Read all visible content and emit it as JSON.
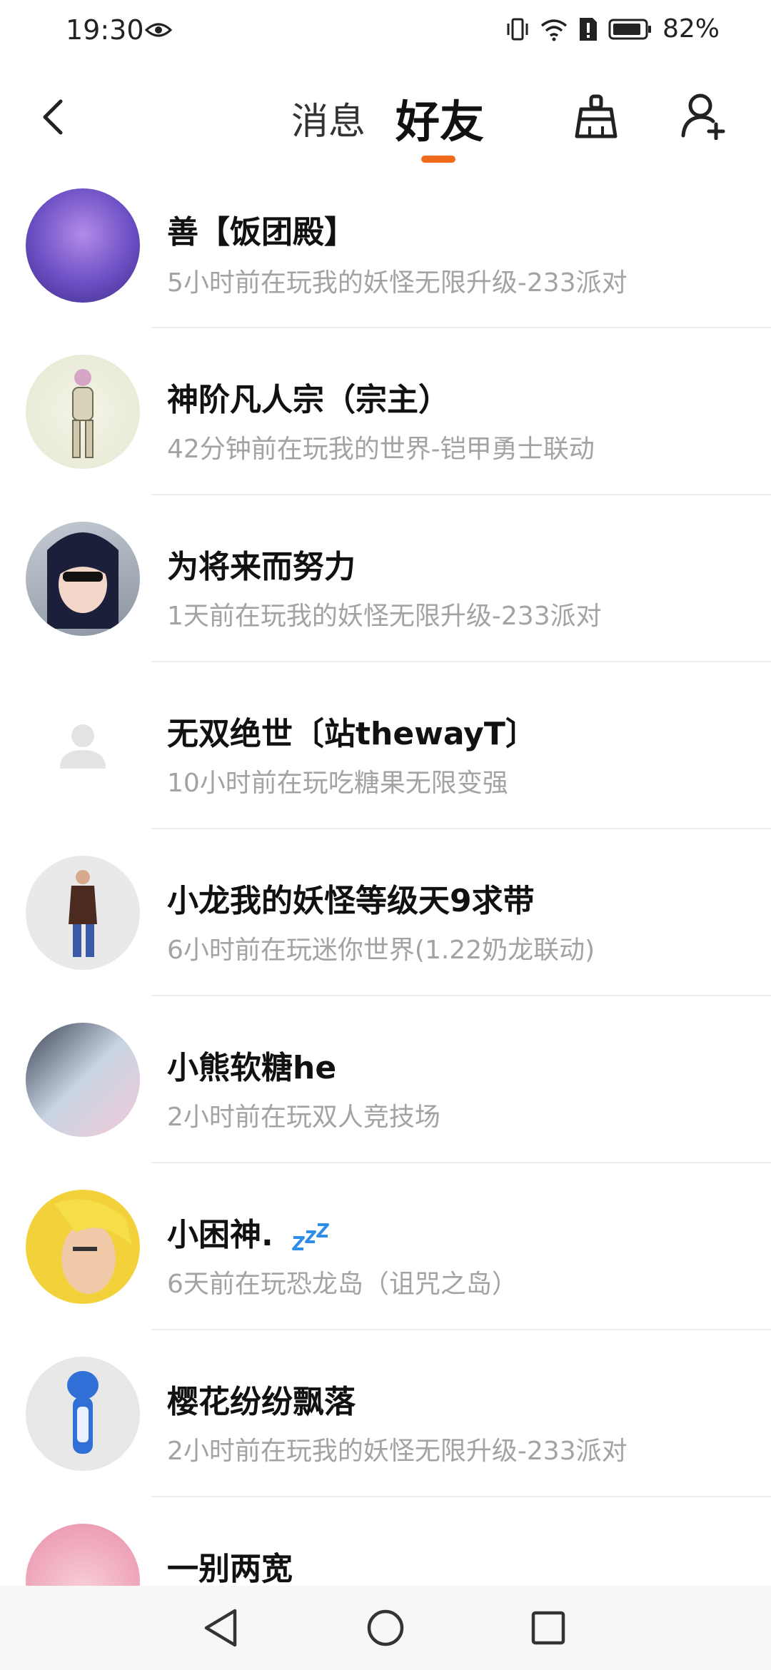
{
  "status_bar": {
    "time": "19:30",
    "battery_percent": "82%"
  },
  "header": {
    "tab_messages": "消息",
    "tab_friends": "好友",
    "accent_color": "#f26a1b"
  },
  "friends": [
    {
      "name": "善【饭团殿】",
      "status": "5小时前在玩我的妖怪无限升级-233派对",
      "avatar_color": "#6b4fc4"
    },
    {
      "name": "神阶凡人宗（宗主）",
      "status": "42分钟前在玩我的世界-铠甲勇士联动",
      "avatar_color": "#eeeede"
    },
    {
      "name": "为将来而努力",
      "status": "1天前在玩我的妖怪无限升级-233派对",
      "avatar_color": "#9aa0aa"
    },
    {
      "name": "无双绝世〔站thewayT〕",
      "status": "10小时前在玩吃糖果无限变强",
      "avatar_color": "#ffffff"
    },
    {
      "name": "小龙我的妖怪等级天9求带",
      "status": "6小时前在玩迷你世界(1.22奶龙联动)",
      "avatar_color": "#e8e8e8"
    },
    {
      "name": "小熊软糖he",
      "status": "2小时前在玩双人竞技场",
      "avatar_color": "#8a9bb0"
    },
    {
      "name": "小困神.",
      "status": "6天前在玩恐龙岛（诅咒之岛）",
      "avatar_color": "#f2d13a"
    },
    {
      "name": "樱花纷纷飘落",
      "status": "2小时前在玩我的妖怪无限升级-233派对",
      "avatar_color": "#e6e6e6"
    },
    {
      "name": "一别两宽",
      "status": "",
      "avatar_color": "#f3b4c2"
    }
  ]
}
